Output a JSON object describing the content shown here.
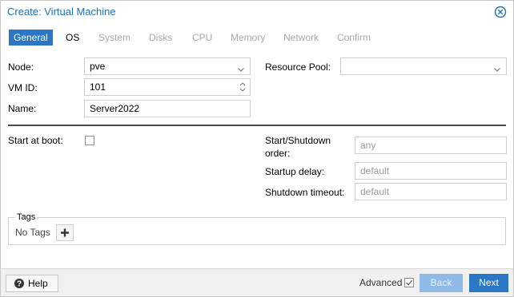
{
  "dialog": {
    "title": "Create: Virtual Machine"
  },
  "tabs": [
    {
      "label": "General",
      "state": "active"
    },
    {
      "label": "OS",
      "state": "enabled"
    },
    {
      "label": "System",
      "state": "disabled"
    },
    {
      "label": "Disks",
      "state": "disabled"
    },
    {
      "label": "CPU",
      "state": "disabled"
    },
    {
      "label": "Memory",
      "state": "disabled"
    },
    {
      "label": "Network",
      "state": "disabled"
    },
    {
      "label": "Confirm",
      "state": "disabled"
    }
  ],
  "form": {
    "node": {
      "label": "Node:",
      "value": "pve"
    },
    "vmid": {
      "label": "VM ID:",
      "value": "101"
    },
    "name": {
      "label": "Name:",
      "value": "Server2022"
    },
    "pool": {
      "label": "Resource Pool:",
      "value": ""
    },
    "start_at_boot": {
      "label": "Start at boot:",
      "checked": false
    },
    "order": {
      "label_line1": "Start/Shutdown",
      "label_line2": "order:",
      "placeholder": "any"
    },
    "startup_delay": {
      "label": "Startup delay:",
      "placeholder": "default"
    },
    "shutdown_timeout": {
      "label": "Shutdown timeout:",
      "placeholder": "default"
    }
  },
  "tags": {
    "legend": "Tags",
    "value": "No Tags"
  },
  "footer": {
    "help_label": "Help",
    "advanced_label": "Advanced",
    "advanced_checked": true,
    "back_label": "Back",
    "next_label": "Next"
  },
  "colors": {
    "accent": "#2a77c6",
    "title": "#1a71bd",
    "disabled_button": "#8fb9e6"
  },
  "icons": {
    "close": "close-circle-icon",
    "dropdown": "chevron-down-icon",
    "spinner": "spinner-icon",
    "add": "plus-icon",
    "help": "question-circle-icon",
    "check": "checkmark-icon"
  }
}
